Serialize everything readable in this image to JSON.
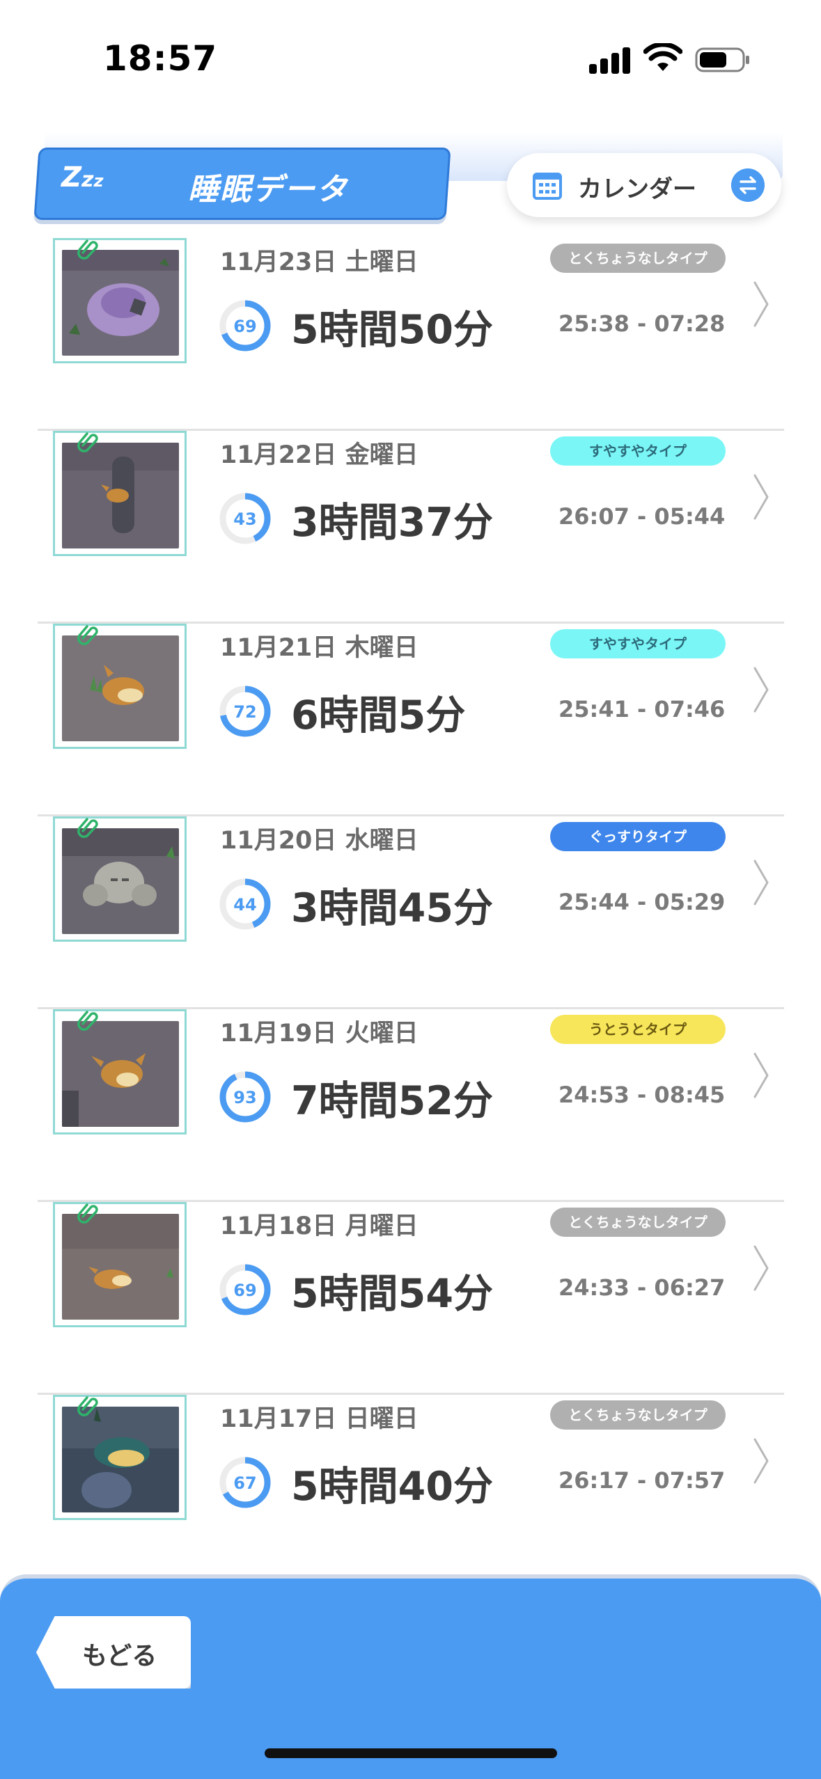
{
  "status_bar": {
    "time": "18:57"
  },
  "header": {
    "zzz": "Zzz",
    "title": "睡眠データ",
    "calendar_label": "カレンダー"
  },
  "entries": [
    {
      "date": "11月23日 土曜日",
      "score": "69",
      "score_value": 69,
      "duration": "5時間50分",
      "type": "とくちょうなしタイプ",
      "type_color": "#b0b0b0",
      "type_text_color": "#ffffff",
      "time_range": "25:38 - 07:28",
      "thumb": "purple-pokemon-sleeping"
    },
    {
      "date": "11月22日 金曜日",
      "score": "43",
      "score_value": 43,
      "duration": "3時間37分",
      "type": "すやすやタイプ",
      "type_color": "#7af6f6",
      "type_text_color": "#2d6a7a",
      "time_range": "26:07 - 05:44",
      "thumb": "eevee-behind-rock"
    },
    {
      "date": "11月21日 木曜日",
      "score": "72",
      "score_value": 72,
      "duration": "6時間5分",
      "type": "すやすやタイプ",
      "type_color": "#7af6f6",
      "type_text_color": "#2d6a7a",
      "time_range": "25:41 - 07:46",
      "thumb": "eevee-sleeping-grass"
    },
    {
      "date": "11月20日 水曜日",
      "score": "44",
      "score_value": 44,
      "duration": "3時間45分",
      "type": "ぐっすりタイプ",
      "type_color": "#3e86ec",
      "type_text_color": "#ffffff",
      "time_range": "25:44 - 05:29",
      "thumb": "geodude-sleeping"
    },
    {
      "date": "11月19日 火曜日",
      "score": "93",
      "score_value": 93,
      "duration": "7時間52分",
      "type": "うとうとタイプ",
      "type_color": "#f7e65a",
      "type_text_color": "#6b5a10",
      "time_range": "24:53 - 08:45",
      "thumb": "eevee-lying"
    },
    {
      "date": "11月18日 月曜日",
      "score": "69",
      "score_value": 69,
      "duration": "5時間54分",
      "type": "とくちょうなしタイプ",
      "type_color": "#b0b0b0",
      "type_text_color": "#ffffff",
      "time_range": "24:33 - 06:27",
      "thumb": "eevee-curled"
    },
    {
      "date": "11月17日 日曜日",
      "score": "67",
      "score_value": 67,
      "duration": "5時間40分",
      "type": "とくちょうなしタイプ",
      "type_color": "#b0b0b0",
      "type_text_color": "#ffffff",
      "time_range": "26:17 - 07:57",
      "thumb": "quilava-sleeping"
    }
  ],
  "footer": {
    "back_label": "もどる"
  },
  "colors": {
    "accent": "#4b9bf2",
    "frame": "#8fd9d4"
  }
}
